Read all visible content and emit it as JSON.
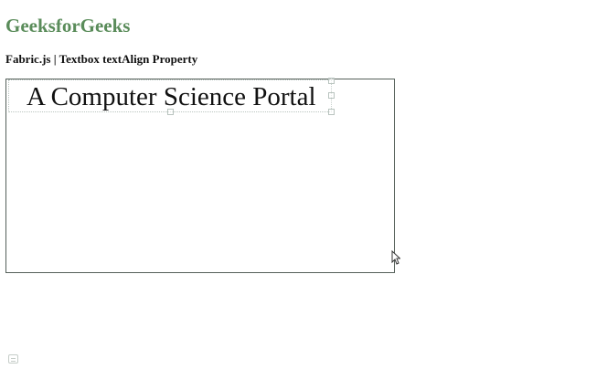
{
  "site": {
    "title": "GeeksforGeeks",
    "title_color": "#5a8c5a"
  },
  "page": {
    "heading": "Fabric.js | Textbox textAlign Property"
  },
  "canvas": {
    "border_color": "#55605a",
    "textbox": {
      "text": "A Computer Science Portal",
      "selected": true
    }
  },
  "icons": {
    "cursor": "mouse-pointer-icon",
    "corner": "window-icon"
  }
}
